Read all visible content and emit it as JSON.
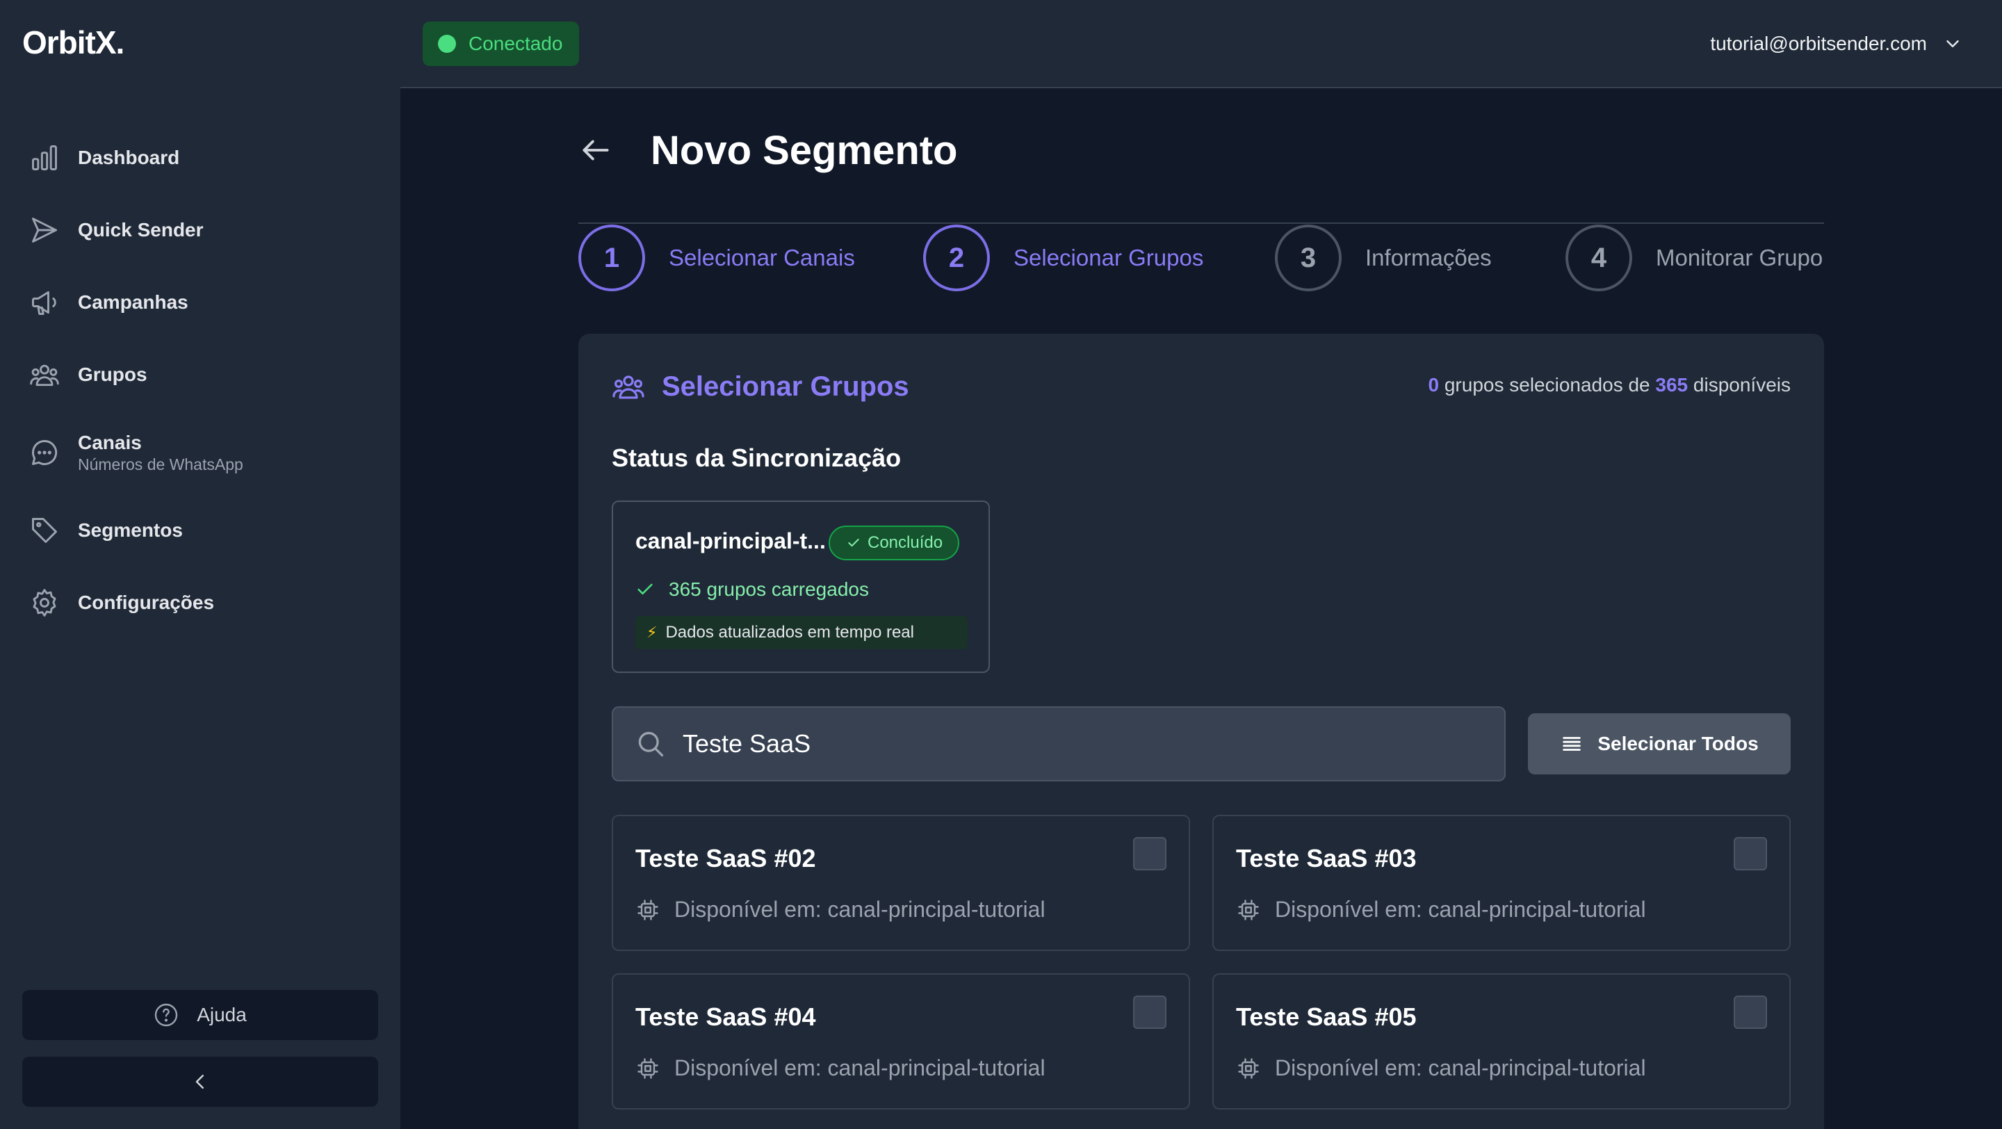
{
  "app": {
    "logo": "OrbitX."
  },
  "sidebar": {
    "items": [
      {
        "label": "Dashboard",
        "icon": "bar-chart-icon"
      },
      {
        "label": "Quick Sender",
        "icon": "send-icon"
      },
      {
        "label": "Campanhas",
        "icon": "megaphone-icon"
      },
      {
        "label": "Grupos",
        "icon": "users-icon"
      },
      {
        "label": "Canais",
        "sub": "Números de WhatsApp",
        "icon": "chat-icon"
      },
      {
        "label": "Segmentos",
        "icon": "tag-icon"
      },
      {
        "label": "Configurações",
        "icon": "gear-icon"
      }
    ],
    "help_label": "Ajuda"
  },
  "topbar": {
    "status": "Conectado",
    "user_email": "tutorial@orbitsender.com"
  },
  "page": {
    "title": "Novo Segmento",
    "steps": [
      {
        "number": "1",
        "label": "Selecionar Canais",
        "active": true
      },
      {
        "number": "2",
        "label": "Selecionar Grupos",
        "active": true
      },
      {
        "number": "3",
        "label": "Informações",
        "active": false
      },
      {
        "number": "4",
        "label": "Monitorar Grupo",
        "active": false
      }
    ]
  },
  "groups_card": {
    "title": "Selecionar Grupos",
    "selected_count": "0",
    "counter_middle": " grupos selecionados de ",
    "available_count": "365",
    "counter_suffix": " disponíveis",
    "sync_title": "Status da Sincronização",
    "sync": {
      "channel": "canal-principal-t...",
      "badge": "Concluído",
      "loaded": "365 grupos carregados",
      "realtime": "Dados atualizados em tempo real"
    },
    "search": {
      "value": "Teste SaaS"
    },
    "select_all_label": "Selecionar Todos",
    "groups": [
      {
        "name": "Teste SaaS #02",
        "available": "Disponível em: canal-principal-tutorial"
      },
      {
        "name": "Teste SaaS #03",
        "available": "Disponível em: canal-principal-tutorial"
      },
      {
        "name": "Teste SaaS #04",
        "available": "Disponível em: canal-principal-tutorial"
      },
      {
        "name": "Teste SaaS #05",
        "available": "Disponível em: canal-principal-tutorial"
      }
    ]
  },
  "colors": {
    "accent": "#8b7cf6",
    "success": "#4ade80",
    "background": "#111827",
    "surface": "#1f2937"
  }
}
